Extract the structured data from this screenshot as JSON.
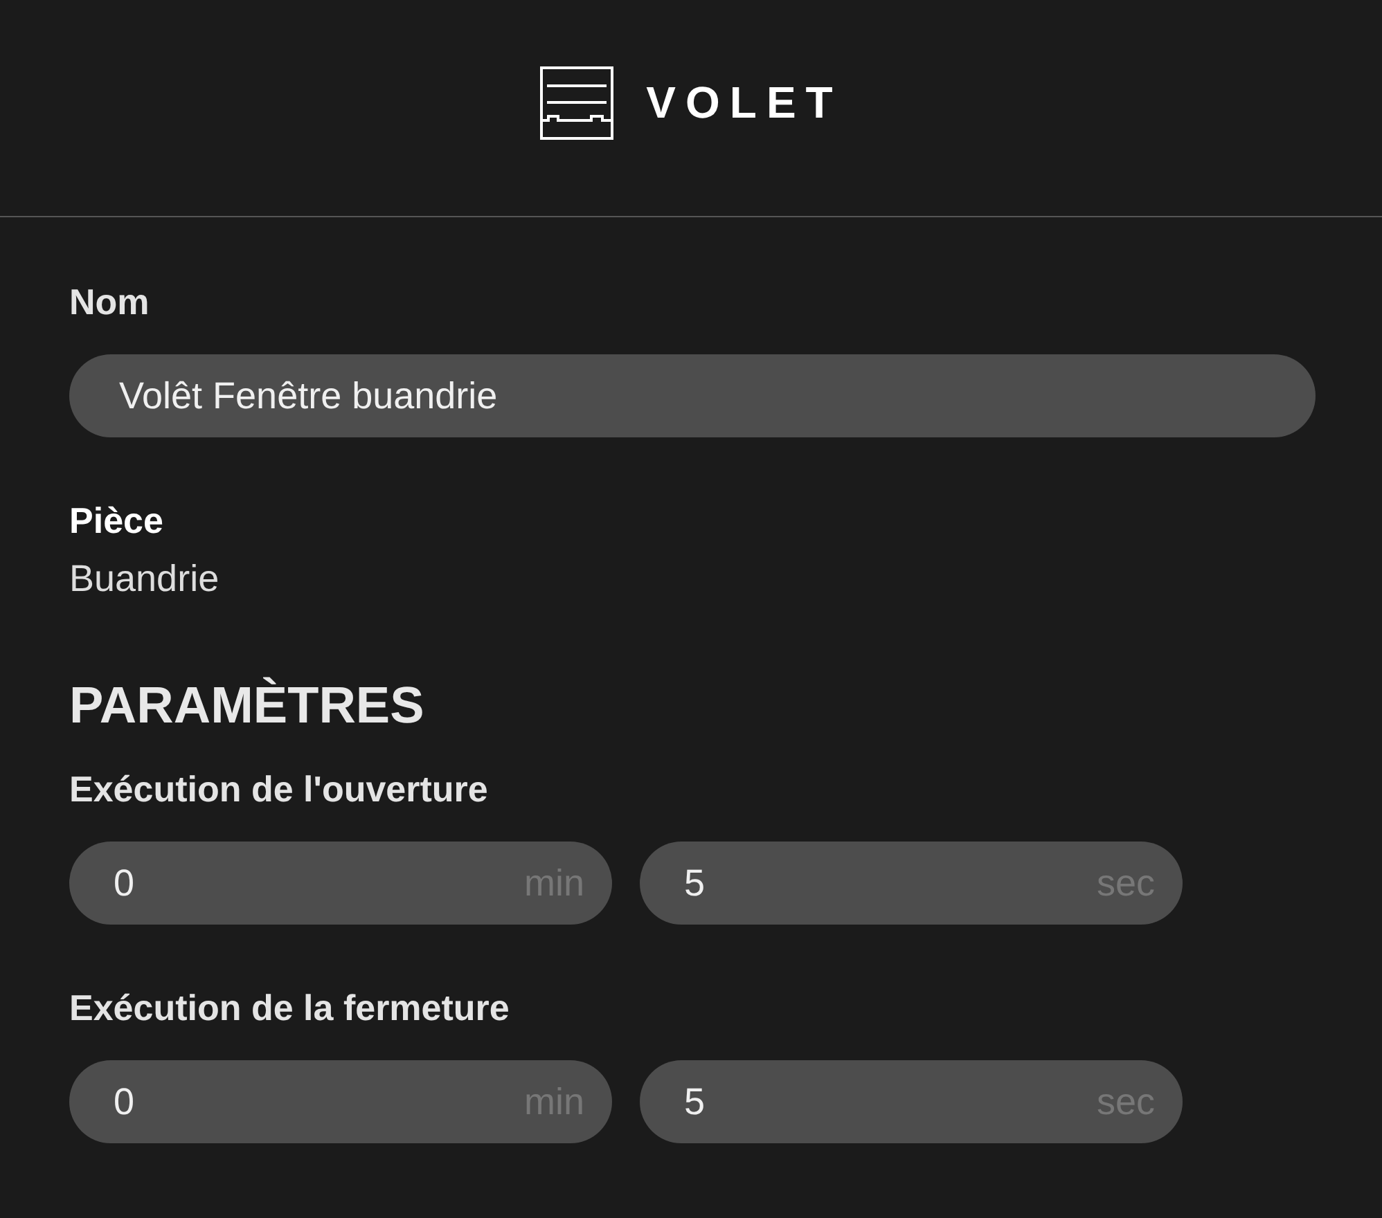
{
  "header": {
    "title": "VOLET"
  },
  "name_field": {
    "label": "Nom",
    "value": "Volêt Fenêtre buandrie"
  },
  "room": {
    "label": "Pièce",
    "value": "Buandrie"
  },
  "parameters": {
    "title": "PARAMÈTRES",
    "groups": [
      {
        "label": "Exécution de l'ouverture",
        "inputs": [
          {
            "value": "0",
            "unit": "min"
          },
          {
            "value": "5",
            "unit": "sec"
          }
        ]
      },
      {
        "label": "Exécution de la fermeture",
        "inputs": [
          {
            "value": "0",
            "unit": "min"
          },
          {
            "value": "5",
            "unit": "sec"
          }
        ]
      }
    ]
  }
}
